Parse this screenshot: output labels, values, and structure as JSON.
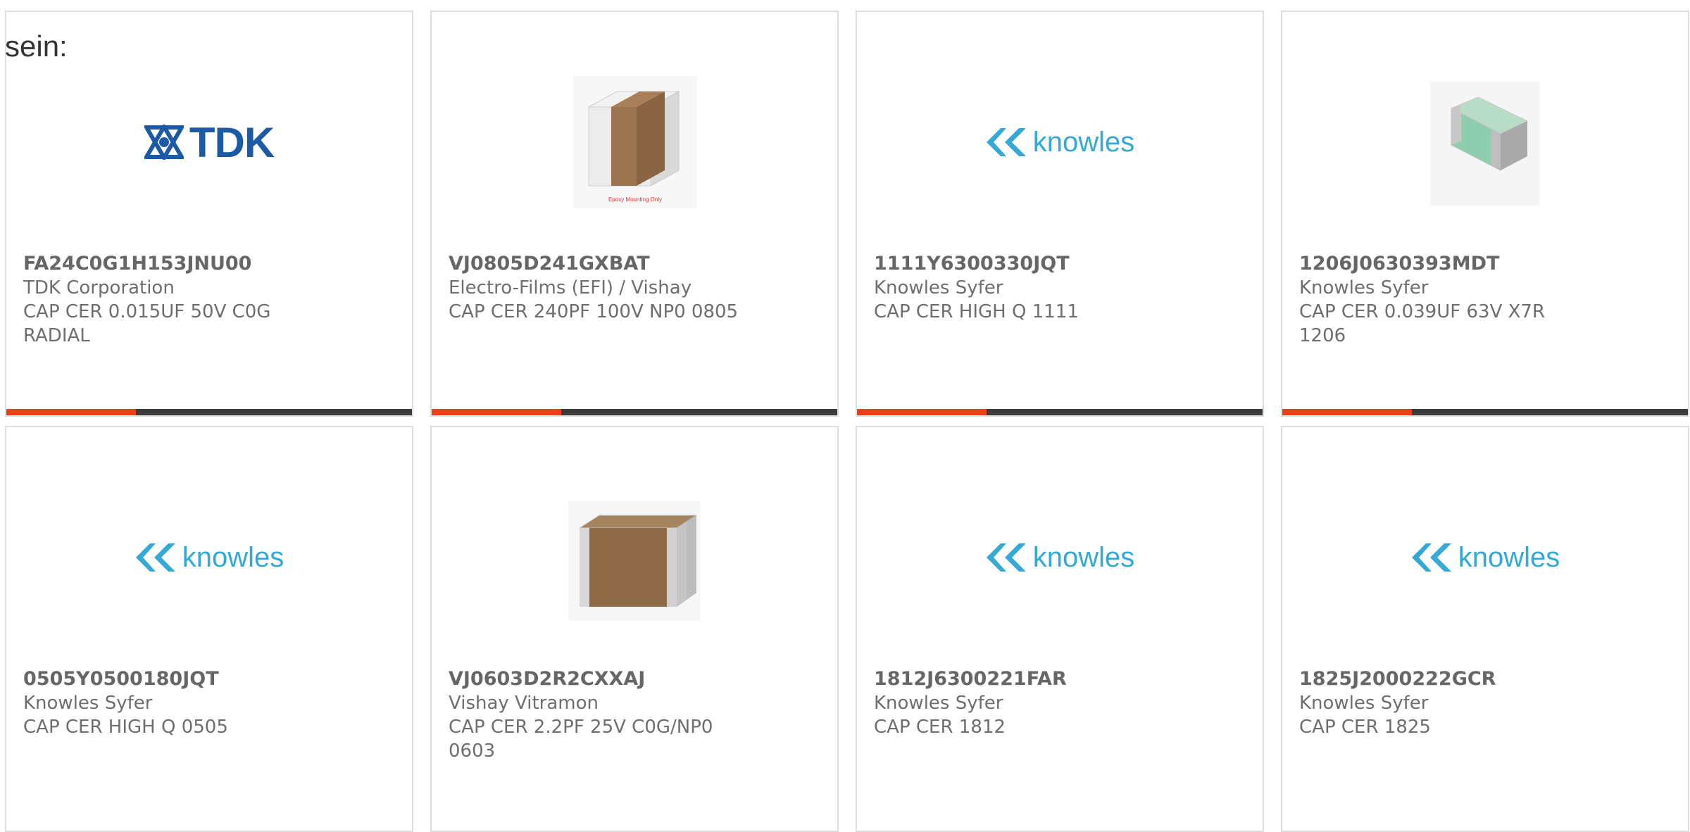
{
  "intro_text": "sein:",
  "colors": {
    "accent": "#e8421a",
    "bar": "#3b3b3b",
    "tdk": "#1c5aa5",
    "knowles": "#35a9d6"
  },
  "products": [
    {
      "part": "FA24C0G1H153JNU00",
      "manufacturer": "TDK Corporation",
      "description": "CAP CER 0.015UF 50V C0G RADIAL",
      "image": "tdk-logo",
      "logo_text": "TDK"
    },
    {
      "part": "VJ0805D241GXBAT",
      "manufacturer": "Electro-Films (EFI) / Vishay",
      "description": "CAP CER 240PF 100V NP0 0805",
      "image": "capacitor-photo-epoxy",
      "image_caption": "Epoxy Mounting Only"
    },
    {
      "part": "1111Y6300330JQT",
      "manufacturer": "Knowles Syfer",
      "description": "CAP CER HIGH Q 1111",
      "image": "knowles-logo",
      "logo_text": "knowles"
    },
    {
      "part": "1206J0630393MDT",
      "manufacturer": "Knowles Syfer",
      "description": "CAP CER 0.039UF 63V X7R 1206",
      "image": "capacitor-photo-green"
    },
    {
      "part": "0505Y0500180JQT",
      "manufacturer": "Knowles Syfer",
      "description": "CAP CER HIGH Q 0505",
      "image": "knowles-logo",
      "logo_text": "knowles"
    },
    {
      "part": "VJ0603D2R2CXXAJ",
      "manufacturer": "Vishay Vitramon",
      "description": "CAP CER 2.2PF 25V C0G/NP0 0603",
      "image": "capacitor-photo-brown"
    },
    {
      "part": "1812J6300221FAR",
      "manufacturer": "Knowles Syfer",
      "description": "CAP CER 1812",
      "image": "knowles-logo",
      "logo_text": "knowles"
    },
    {
      "part": "1825J2000222GCR",
      "manufacturer": "Knowles Syfer",
      "description": "CAP CER 1825",
      "image": "knowles-logo",
      "logo_text": "knowles"
    }
  ]
}
